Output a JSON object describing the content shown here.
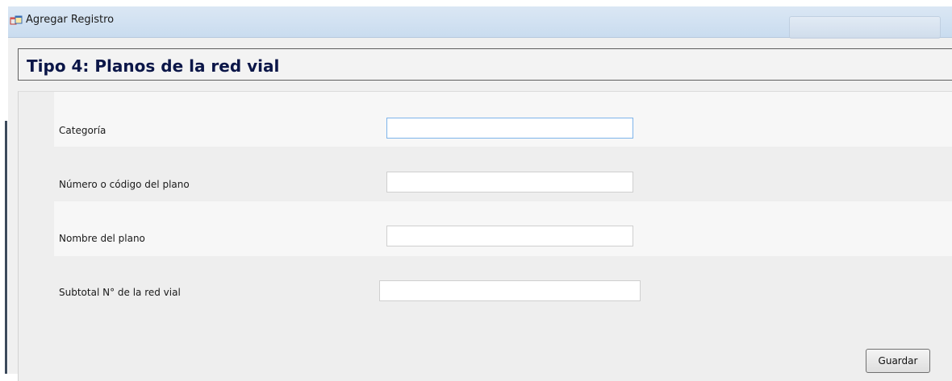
{
  "window": {
    "title": "Agregar Registro",
    "icon": "app-window-icon"
  },
  "header": {
    "title": "Tipo 4: Planos de la red vial"
  },
  "form": {
    "fields": [
      {
        "label": "Categoría",
        "value": ""
      },
      {
        "label": "Número o código del plano",
        "value": ""
      },
      {
        "label": "Nombre del plano",
        "value": ""
      },
      {
        "label": "Subtotal N° de la red vial",
        "value": ""
      }
    ],
    "save_label": "Guardar"
  },
  "colors": {
    "header_text": "#0b1648",
    "titlebar": "#c9dcef",
    "panel_bg": "#eeeeee",
    "focus_border": "#7eb4ea"
  }
}
